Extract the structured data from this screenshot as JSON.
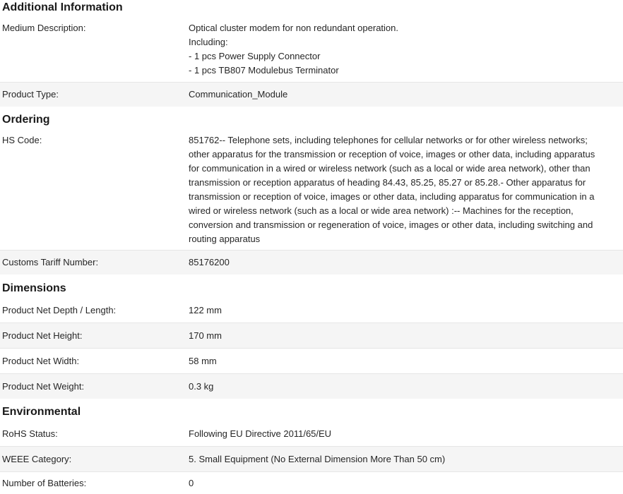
{
  "sections": [
    {
      "title": "Additional Information",
      "rows": [
        {
          "label": "Medium Description:",
          "lines": [
            "Optical cluster modem for non redundant operation.",
            "Including:",
            "- 1 pcs Power Supply Connector",
            "- 1 pcs TB807 Modulebus Terminator"
          ]
        },
        {
          "label": "Product Type:",
          "lines": [
            "Communication_Module"
          ]
        }
      ]
    },
    {
      "title": "Ordering",
      "rows": [
        {
          "label": "HS Code:",
          "lines": [
            "851762-- Telephone sets, including telephones for cellular networks or for other wireless networks;",
            "other apparatus for the transmission or reception of voice, images or other data, including apparatus",
            "for communication in a wired or wireless network (such as a local or wide area network), other than",
            "transmission or reception apparatus of heading 84.43, 85.25, 85.27 or 85.28.- Other apparatus for",
            "transmission or reception of voice, images or other data, including apparatus for communication in a",
            "wired or wireless network (such as a local or wide area network) :-- Machines for the reception,",
            "conversion and transmission or regeneration of voice, images or other data, including switching and",
            "routing apparatus"
          ]
        },
        {
          "label": "Customs Tariff Number:",
          "lines": [
            "85176200"
          ]
        }
      ]
    },
    {
      "title": "Dimensions",
      "rows": [
        {
          "label": "Product Net Depth / Length:",
          "lines": [
            "122 mm"
          ]
        },
        {
          "label": "Product Net Height:",
          "lines": [
            "170 mm"
          ]
        },
        {
          "label": "Product Net Width:",
          "lines": [
            "58 mm"
          ]
        },
        {
          "label": "Product Net Weight:",
          "lines": [
            "0.3 kg"
          ]
        }
      ]
    },
    {
      "title": "Environmental",
      "rows": [
        {
          "label": "RoHS Status:",
          "lines": [
            "Following EU Directive 2011/65/EU"
          ]
        },
        {
          "label": "WEEE Category:",
          "lines": [
            "5. Small Equipment (No External Dimension More Than 50 cm)"
          ]
        },
        {
          "label": "Number of Batteries:",
          "lines": [
            "0"
          ]
        }
      ]
    }
  ]
}
